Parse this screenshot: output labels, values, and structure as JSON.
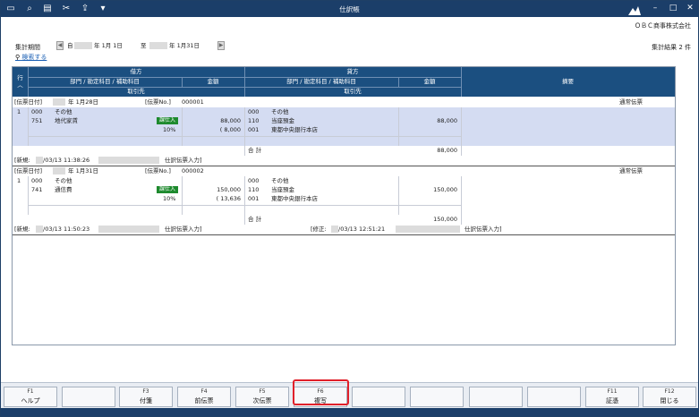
{
  "window": {
    "title": "仕訳帳",
    "company": "ＯＢＣ商事株式会社"
  },
  "toolbar": {
    "icons": [
      "window-icon",
      "search-icon",
      "print-icon",
      "tools-icon",
      "export-icon",
      "dropdown-icon"
    ]
  },
  "filter": {
    "period_label": "集計期間",
    "from_prefix": "自",
    "from_date": "年  1月 1日",
    "to_prefix": "至",
    "to_date": "年  1月31日",
    "search_link": "検索する",
    "result": "集計結果 2 件"
  },
  "header": {
    "row_label": "行",
    "debit": "借方",
    "credit": "貸方",
    "dept_account": "部門 / 勘定科目 / 補助科目",
    "amount": "金額",
    "partner": "取引先",
    "memo": "摘要"
  },
  "vouchers": [
    {
      "date_label": "[伝票日付]",
      "date": "年  1月28日",
      "no_label": "[伝票No.]",
      "no": "000001",
      "type": "通常伝票",
      "line_no": "1",
      "debit_dept": "000",
      "debit_dept_name": "その他",
      "debit_acct": "751",
      "debit_acct_name": "地代家賃",
      "tax_badge": "課仕入",
      "tax_rate": "10%",
      "debit_amount": "88,000",
      "debit_tax": "( 8,000",
      "credit_dept": "000",
      "credit_dept_name": "その他",
      "credit_acct": "110",
      "credit_acct_name": "当座預金",
      "credit_sub": "001",
      "credit_sub_name": "東都中央銀行本店",
      "credit_amount": "88,000",
      "total_label": "合 計",
      "total": "88,000",
      "new_label": "[新規:",
      "new_time": "/03/13 11:38:26",
      "new_source": "仕訳伝票入力]"
    },
    {
      "date_label": "[伝票日付]",
      "date": "年  1月31日",
      "no_label": "[伝票No.]",
      "no": "000002",
      "type": "通常伝票",
      "line_no": "1",
      "debit_dept": "000",
      "debit_dept_name": "その他",
      "debit_acct": "741",
      "debit_acct_name": "通信費",
      "tax_badge": "課仕入",
      "tax_rate": "10%",
      "debit_amount": "150,000",
      "debit_tax": "( 13,636",
      "credit_dept": "000",
      "credit_dept_name": "その他",
      "credit_acct": "110",
      "credit_acct_name": "当座預金",
      "credit_sub": "001",
      "credit_sub_name": "東都中央銀行本店",
      "credit_amount": "150,000",
      "total_label": "合 計",
      "total": "150,000",
      "new_label": "[新規:",
      "new_time": "/03/13 11:50:23",
      "new_source": "仕訳伝票入力]",
      "mod_label": "[修正:",
      "mod_time": "/03/13 12:51:21",
      "mod_source": "仕訳伝票入力]"
    }
  ],
  "fkeys": [
    {
      "key": "F1",
      "label": "ヘルプ"
    },
    {
      "key": "",
      "label": ""
    },
    {
      "key": "F3",
      "label": "付箋"
    },
    {
      "key": "F4",
      "label": "前伝票"
    },
    {
      "key": "F5",
      "label": "次伝票"
    },
    {
      "key": "F6",
      "label": "複写"
    },
    {
      "key": "",
      "label": ""
    },
    {
      "key": "",
      "label": ""
    },
    {
      "key": "",
      "label": ""
    },
    {
      "key": "",
      "label": ""
    },
    {
      "key": "F11",
      "label": "証憑"
    },
    {
      "key": "F12",
      "label": "閉じる"
    }
  ],
  "colors": {
    "titlebar": "#1b3e69",
    "header": "#1b4f80",
    "selected_row": "#d4dcf2",
    "badge": "#1e8a2e",
    "highlight": "#e0202a"
  }
}
